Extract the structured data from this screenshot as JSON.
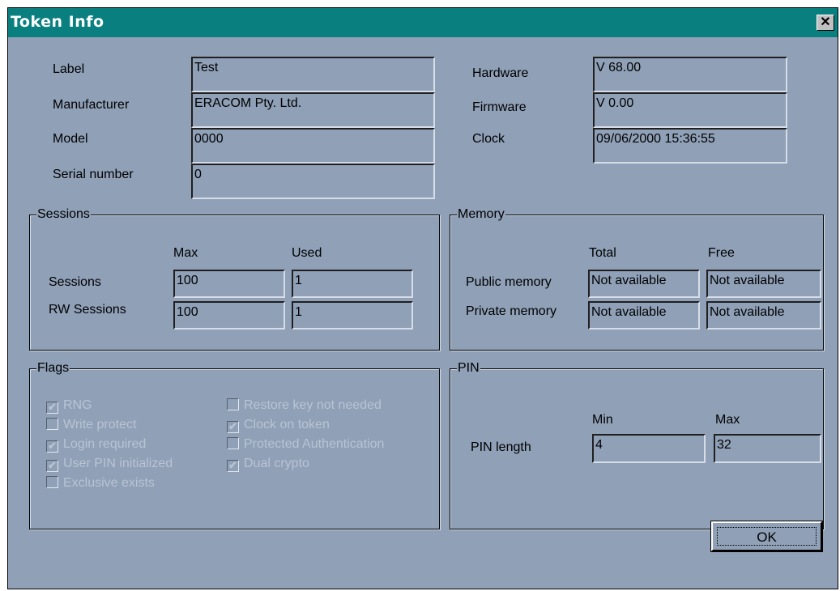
{
  "window": {
    "title": "Token Info",
    "close_glyph": "✕"
  },
  "info": {
    "label_label": "Label",
    "label_value": "Test",
    "manufacturer_label": "Manufacturer",
    "manufacturer_value": "ERACOM Pty. Ltd.",
    "model_label": "Model",
    "model_value": "0000",
    "serial_label": "Serial number",
    "serial_value": "0",
    "hardware_label": "Hardware",
    "hardware_value": "V 68.00",
    "firmware_label": "Firmware",
    "firmware_value": "V 0.00",
    "clock_label": "Clock",
    "clock_value": "09/06/2000 15:36:55"
  },
  "sessions": {
    "title": "Sessions",
    "max_header": "Max",
    "used_header": "Used",
    "sessions_label": "Sessions",
    "sessions_max": "100",
    "sessions_used": "1",
    "rw_label": "RW Sessions",
    "rw_max": "100",
    "rw_used": "1"
  },
  "memory": {
    "title": "Memory",
    "total_header": "Total",
    "free_header": "Free",
    "public_label": "Public memory",
    "public_total": "Not available",
    "public_free": "Not available",
    "private_label": "Private memory",
    "private_total": "Not available",
    "private_free": "Not available"
  },
  "flags": {
    "title": "Flags",
    "items": [
      {
        "label": "RNG",
        "checked": true
      },
      {
        "label": "Write protect",
        "checked": false
      },
      {
        "label": "Login required",
        "checked": true
      },
      {
        "label": "User PIN initialized",
        "checked": true
      },
      {
        "label": "Exclusive exists",
        "checked": false
      },
      {
        "label": "Restore key not needed",
        "checked": false
      },
      {
        "label": "Clock on token",
        "checked": true
      },
      {
        "label": "Protected Authentication",
        "checked": false
      },
      {
        "label": "Dual crypto",
        "checked": true
      }
    ]
  },
  "pin": {
    "title": "PIN",
    "min_header": "Min",
    "max_header": "Max",
    "length_label": "PIN length",
    "min_value": "4",
    "max_value": "32"
  },
  "buttons": {
    "ok": "OK"
  },
  "colors": {
    "titlebar": "#0a7f7f",
    "dialog_bg": "#8fa0b7",
    "disabled_text": "#b9c4d3"
  }
}
